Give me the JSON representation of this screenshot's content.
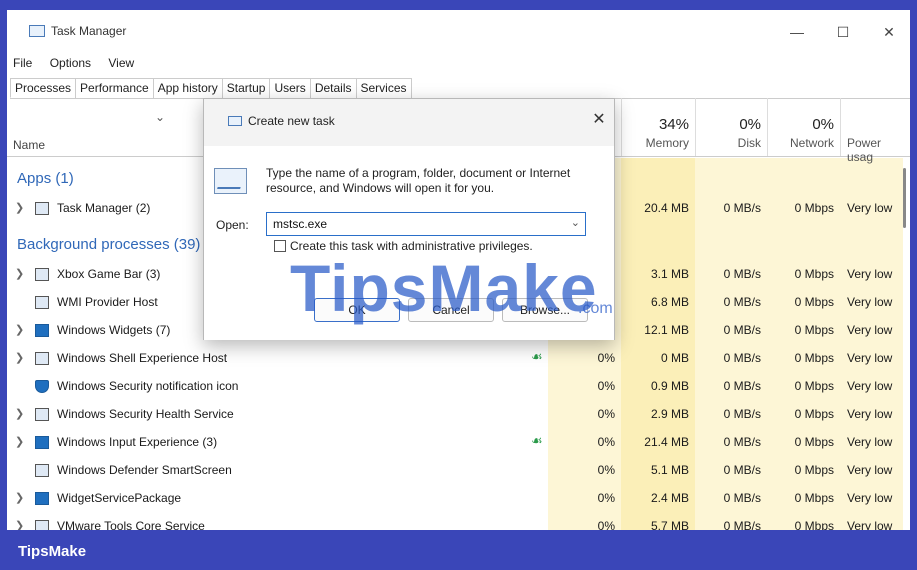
{
  "window": {
    "title": "Task Manager"
  },
  "menu": [
    "File",
    "Options",
    "View"
  ],
  "tabs": [
    "Processes",
    "Performance",
    "App history",
    "Startup",
    "Users",
    "Details",
    "Services"
  ],
  "columns": {
    "name": "Name",
    "memory": {
      "pct": "34%",
      "label": "Memory"
    },
    "disk": {
      "pct": "0%",
      "label": "Disk"
    },
    "network": {
      "pct": "0%",
      "label": "Network"
    },
    "power": {
      "label": "Power usag"
    }
  },
  "sections": {
    "apps": "Apps (1)",
    "background": "Background processes (39)"
  },
  "rows": [
    {
      "name": "Task Manager (2)",
      "cpu": "",
      "memory": "20.4 MB",
      "disk": "0 MB/s",
      "network": "0 Mbps",
      "power": "Very low"
    },
    {
      "name": "Xbox Game Bar (3)",
      "cpu": "",
      "memory": "3.1 MB",
      "disk": "0 MB/s",
      "network": "0 Mbps",
      "power": "Very low"
    },
    {
      "name": "WMI Provider Host",
      "cpu": "",
      "memory": "6.8 MB",
      "disk": "0 MB/s",
      "network": "0 Mbps",
      "power": "Very low"
    },
    {
      "name": "Windows Widgets (7)",
      "cpu": "",
      "memory": "12.1 MB",
      "disk": "0 MB/s",
      "network": "0 Mbps",
      "power": "Very low"
    },
    {
      "name": "Windows Shell Experience Host",
      "cpu": "0%",
      "memory": "0 MB",
      "disk": "0 MB/s",
      "network": "0 Mbps",
      "power": "Very low"
    },
    {
      "name": "Windows Security notification icon",
      "cpu": "0%",
      "memory": "0.9 MB",
      "disk": "0 MB/s",
      "network": "0 Mbps",
      "power": "Very low"
    },
    {
      "name": "Windows Security Health Service",
      "cpu": "0%",
      "memory": "2.9 MB",
      "disk": "0 MB/s",
      "network": "0 Mbps",
      "power": "Very low"
    },
    {
      "name": "Windows Input Experience (3)",
      "cpu": "0%",
      "memory": "21.4 MB",
      "disk": "0 MB/s",
      "network": "0 Mbps",
      "power": "Very low"
    },
    {
      "name": "Windows Defender SmartScreen",
      "cpu": "0%",
      "memory": "5.1 MB",
      "disk": "0 MB/s",
      "network": "0 Mbps",
      "power": "Very low"
    },
    {
      "name": "WidgetServicePackage",
      "cpu": "0%",
      "memory": "2.4 MB",
      "disk": "0 MB/s",
      "network": "0 Mbps",
      "power": "Very low"
    },
    {
      "name": "VMware Tools Core Service",
      "cpu": "0%",
      "memory": "5.7 MB",
      "disk": "0 MB/s",
      "network": "0 Mbps",
      "power": "Very low"
    }
  ],
  "dialog": {
    "title": "Create new task",
    "description": "Type the name of a program, folder, document or Internet resource, and Windows will open it for you.",
    "open_label": "Open:",
    "open_value": "mstsc.exe",
    "admin_checkbox_label": "Create this task with administrative privileges.",
    "admin_checked": false,
    "ok": "OK",
    "cancel": "Cancel",
    "browse": "Browse..."
  },
  "watermark": {
    "text": "TipsMake",
    "suffix": ".com"
  },
  "footer": {
    "brand": "TipsMake"
  },
  "colors": {
    "frame": "#3a46b8",
    "heat_light": "#fdf6d6",
    "heat_mid": "#fbefb8",
    "accent": "#3068b8"
  }
}
